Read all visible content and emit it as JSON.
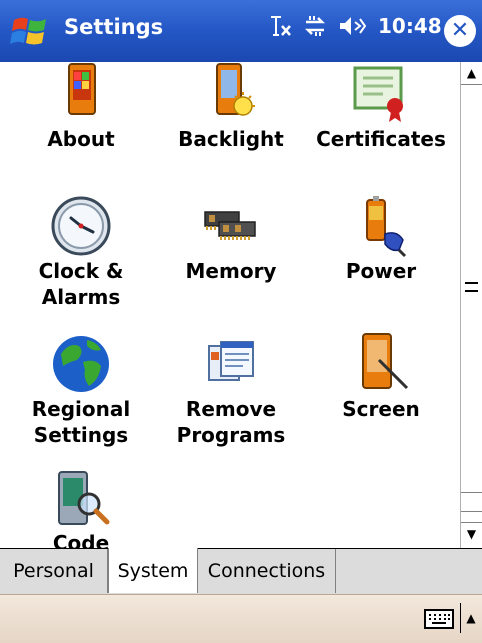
{
  "window": {
    "title": "Settings",
    "time": "10:48"
  },
  "apps": [
    {
      "label": "About",
      "icon": "about-icon"
    },
    {
      "label": "Backlight",
      "icon": "backlight-icon"
    },
    {
      "label": "Certificates",
      "icon": "certificates-icon"
    },
    {
      "label": "Clock &\nAlarms",
      "icon": "clock-icon"
    },
    {
      "label": "Memory",
      "icon": "memory-icon"
    },
    {
      "label": "Power",
      "icon": "power-icon"
    },
    {
      "label": "Regional\nSettings",
      "icon": "globe-icon"
    },
    {
      "label": "Remove\nPrograms",
      "icon": "remove-programs-icon"
    },
    {
      "label": "Screen",
      "icon": "screen-icon"
    },
    {
      "label": "Code",
      "icon": "search-device-icon"
    }
  ],
  "tabs": [
    {
      "label": "Personal"
    },
    {
      "label": "System",
      "selected": true
    },
    {
      "label": "Connections"
    }
  ],
  "colors": {
    "titlebar": "#2457c5",
    "tabbar": "#dcdcdc",
    "menubar": "#ecdfd1"
  }
}
